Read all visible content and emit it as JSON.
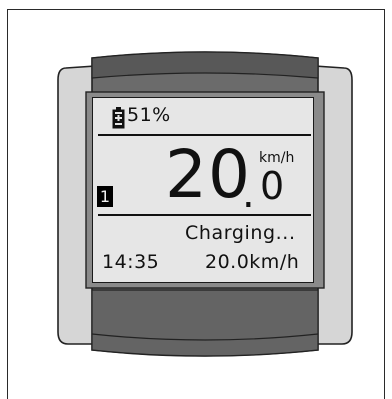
{
  "display": {
    "battery_percent": "51%",
    "assist_level": "1",
    "speed_integer": "20",
    "speed_dot": ".",
    "speed_decimal": "0",
    "speed_unit": "km/h",
    "status": "Charging...",
    "time": "14:35",
    "secondary_speed": "20.0km/h"
  },
  "battery": {
    "level_fraction": 0.51
  },
  "colors": {
    "casing_dark": "#5a5a5a",
    "casing_mid": "#7a7a7a",
    "bezel_light": "#d9d9d9",
    "screen_bg": "#e6e6e6",
    "ink": "#111111"
  }
}
